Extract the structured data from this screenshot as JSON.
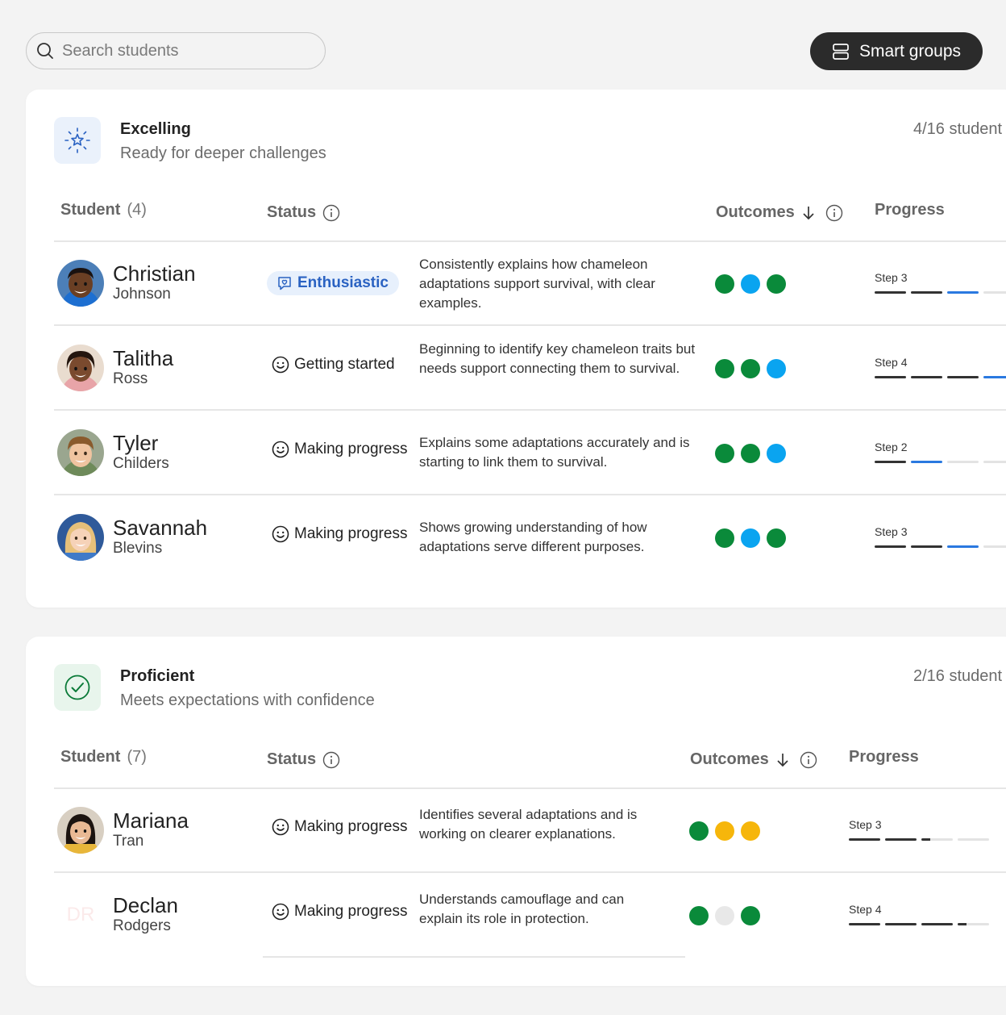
{
  "search": {
    "placeholder": "Search students"
  },
  "smart_groups_label": "Smart groups",
  "colors": {
    "green": "#0a8a3a",
    "blue": "#0aa4f0",
    "yellow": "#f6b60b",
    "grey": "#e8e8e8",
    "seg_done": "#333333",
    "seg_current": "#2a79e0",
    "seg_todo": "#e3e3e3"
  },
  "groups": [
    {
      "icon": "star-sparkle-icon",
      "title": "Excelling",
      "subtitle": "Ready for deeper challenges",
      "count": "4/16 student",
      "headers": {
        "student": "Student",
        "student_count": "(4)",
        "status": "Status",
        "outcomes": "Outcomes",
        "progress": "Progress"
      },
      "students": [
        {
          "first": "Christian",
          "last": "Johnson",
          "status": "Enthusiastic",
          "status_style": "pill",
          "description": "Consistently explains how chameleon adaptations support survival, with clear examples.",
          "outcomes": [
            "green",
            "blue",
            "green"
          ],
          "step": "Step 3",
          "segments": [
            "done",
            "done",
            "current",
            "todo"
          ]
        },
        {
          "first": "Talitha",
          "last": "Ross",
          "status": "Getting started",
          "status_style": "plain",
          "description": "Beginning to identify key chameleon traits but needs support connecting them to survival.",
          "outcomes": [
            "green",
            "green",
            "blue"
          ],
          "step": "Step 4",
          "segments": [
            "done",
            "done",
            "done",
            "current"
          ]
        },
        {
          "first": "Tyler",
          "last": "Childers",
          "status": "Making progress",
          "status_style": "plain",
          "description": "Explains some adaptations accurately and is starting to link them to survival.",
          "outcomes": [
            "green",
            "green",
            "blue"
          ],
          "step": "Step 2",
          "segments": [
            "done",
            "current",
            "todo",
            "todo"
          ]
        },
        {
          "first": "Savannah",
          "last": "Blevins",
          "status": "Making progress",
          "status_style": "plain",
          "description": "Shows growing understanding of how adaptations serve different purposes.",
          "outcomes": [
            "green",
            "blue",
            "green"
          ],
          "step": "Step 3",
          "segments": [
            "done",
            "done",
            "current",
            "todo"
          ]
        }
      ]
    },
    {
      "icon": "check-circle-icon",
      "title": "Proficient",
      "subtitle": "Meets expectations with confidence",
      "count": "2/16 student",
      "headers": {
        "student": "Student",
        "student_count": "(7)",
        "status": "Status",
        "outcomes": "Outcomes",
        "progress": "Progress"
      },
      "students": [
        {
          "first": "Mariana",
          "last": "Tran",
          "status": "Making progress",
          "status_style": "plain",
          "description": "Identifies several adaptations and is working on clearer explanations.",
          "outcomes": [
            "green",
            "yellow",
            "yellow"
          ],
          "step": "Step 3",
          "segments": [
            "done",
            "done",
            "partial",
            "todo"
          ]
        },
        {
          "first": "Declan",
          "last": "Rodgers",
          "initials": "DR",
          "status": "Making progress",
          "status_style": "plain",
          "description": "Understands camouflage and can explain its role in protection.",
          "outcomes": [
            "green",
            "grey",
            "green"
          ],
          "step": "Step 4",
          "segments": [
            "done",
            "done",
            "done",
            "partial"
          ]
        }
      ]
    }
  ]
}
